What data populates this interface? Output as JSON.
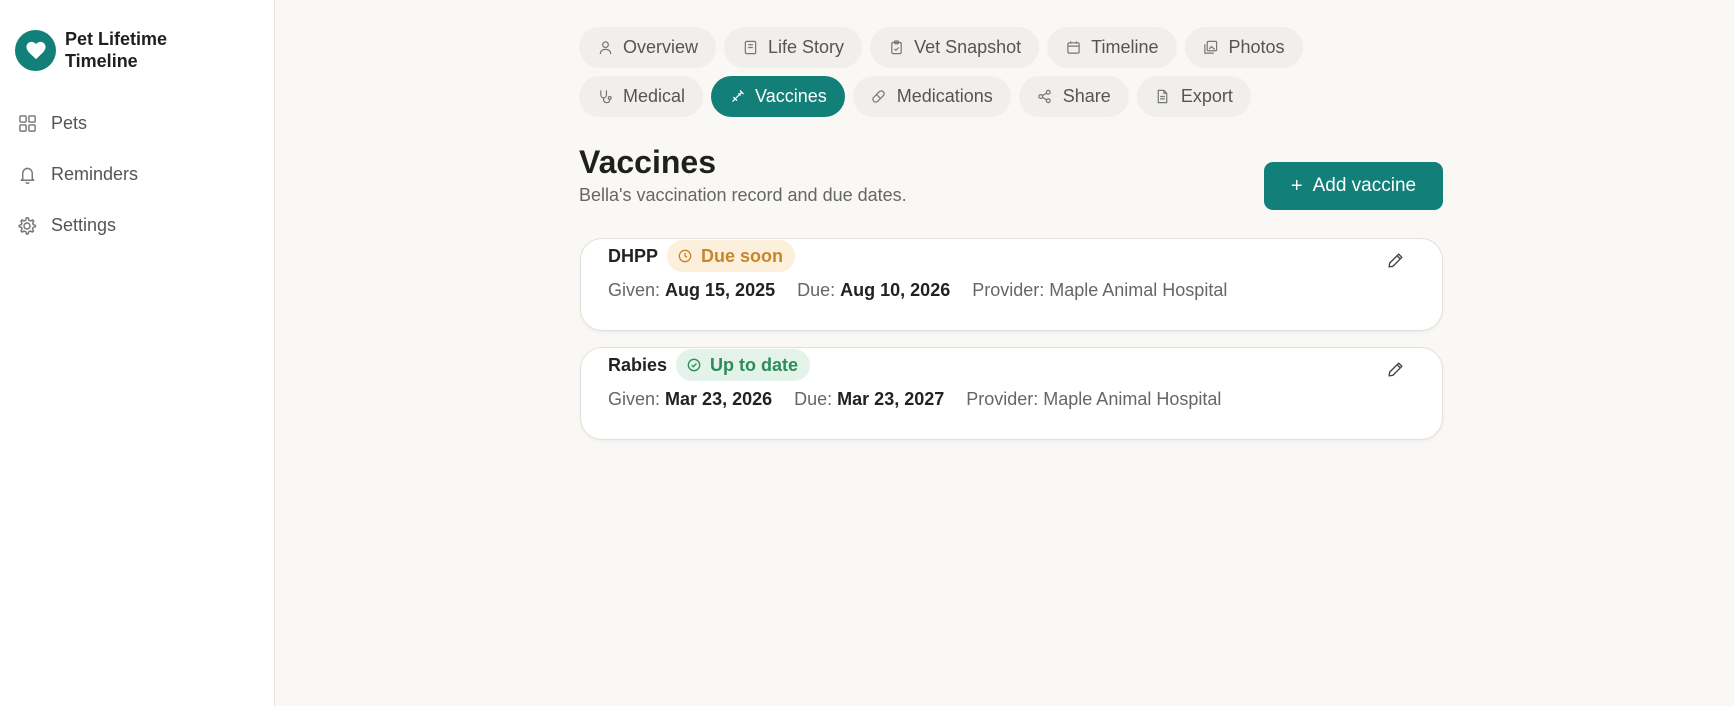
{
  "app": {
    "title": "Pet Lifetime Timeline"
  },
  "sidebar": {
    "items": [
      {
        "label": "Pets",
        "icon": "grid-icon"
      },
      {
        "label": "Reminders",
        "icon": "bell-icon"
      },
      {
        "label": "Settings",
        "icon": "gear-icon"
      }
    ]
  },
  "tabs": [
    {
      "label": "Overview",
      "icon": "user-icon"
    },
    {
      "label": "Life Story",
      "icon": "book-icon"
    },
    {
      "label": "Vet Snapshot",
      "icon": "clipboard-icon"
    },
    {
      "label": "Timeline",
      "icon": "calendar-icon"
    },
    {
      "label": "Photos",
      "icon": "images-icon"
    },
    {
      "label": "Medical",
      "icon": "stethoscope-icon"
    },
    {
      "label": "Vaccines",
      "icon": "syringe-icon",
      "active": true
    },
    {
      "label": "Medications",
      "icon": "pill-icon"
    },
    {
      "label": "Share",
      "icon": "share-icon"
    },
    {
      "label": "Export",
      "icon": "file-icon"
    }
  ],
  "page": {
    "title": "Vaccines",
    "subtitle": "Bella's vaccination record and due dates.",
    "add_button": "Add vaccine"
  },
  "vaccines": [
    {
      "name": "DHPP",
      "status": "Due soon",
      "status_icon": "clock-icon",
      "given_label": "Given:",
      "given": "Aug 15, 2025",
      "due_label": "Due:",
      "due": "Aug 10, 2026",
      "provider": "Provider: Maple Animal Hospital"
    },
    {
      "name": "Rabies",
      "status": "Up to date",
      "status_icon": "check-circle-icon",
      "given_label": "Given:",
      "given": "Mar 23, 2026",
      "due_label": "Due:",
      "due": "Mar 23, 2027",
      "provider": "Provider: Maple Animal Hospital"
    }
  ],
  "colors": {
    "accent": "#127f78",
    "background": "#faf8f5",
    "due_soon": "#c7862c",
    "up_to_date": "#2e8b5a"
  }
}
